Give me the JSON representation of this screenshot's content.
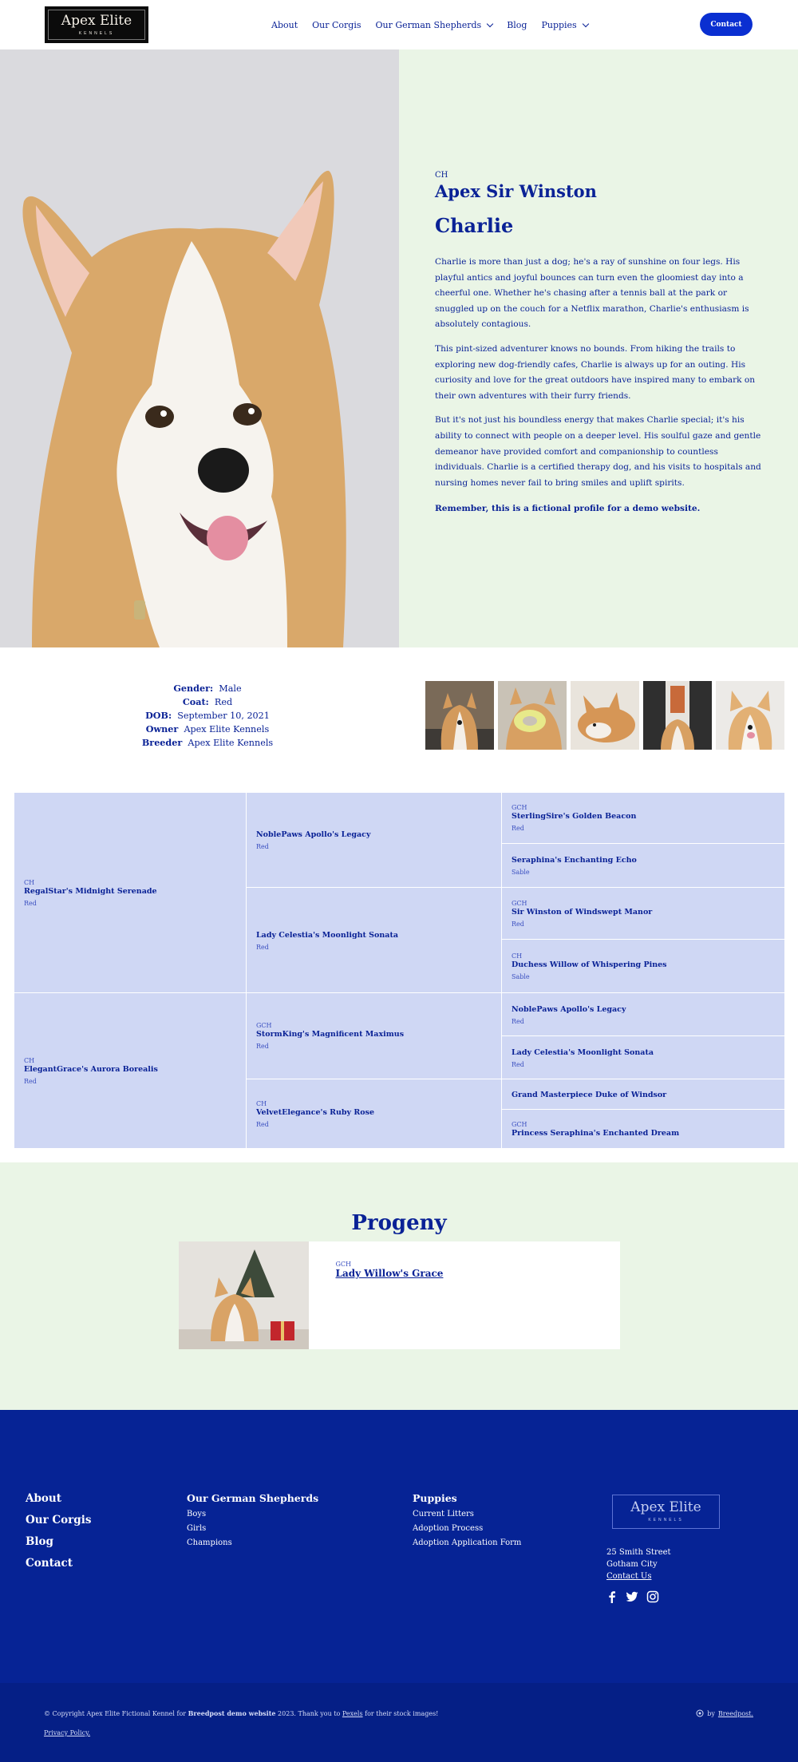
{
  "header": {
    "logo_name": "Apex Elite",
    "logo_sub": "KENNELS",
    "nav": [
      "About",
      "Our Corgis",
      "Our German Shepherds",
      "Blog",
      "Puppies"
    ],
    "contact": "Contact"
  },
  "hero": {
    "prefix": "CH",
    "name": "Apex Sir Winston",
    "call_name": "Charlie",
    "paragraphs": [
      "Charlie is more than just a dog; he's a ray of sunshine on four legs. His playful antics and joyful bounces can turn even the gloomiest day into a cheerful one. Whether he's chasing after a tennis ball at the park or snuggled up on the couch for a Netflix marathon, Charlie's enthusiasm is absolutely contagious.",
      "This pint-sized adventurer knows no bounds. From hiking the trails to exploring new dog-friendly cafes, Charlie is always up for an outing. His curiosity and love for the great outdoors have inspired many to embark on their own adventures with their furry friends.",
      "But it's not just his boundless energy that makes Charlie special; it's his ability to connect with people on a deeper level. His soulful gaze and gentle demeanor have provided comfort and companionship to countless individuals. Charlie is a certified therapy dog, and his visits to hospitals and nursing homes never fail to bring smiles and uplift spirits."
    ],
    "disclaimer": "Remember, this is a fictional profile for a demo website."
  },
  "info": {
    "gender_label": "Gender:",
    "gender": "Male",
    "coat_label": "Coat:",
    "coat": "Red",
    "dob_label": "DOB:",
    "dob": "September 10, 2021",
    "owner_label": "Owner",
    "owner": "Apex Elite Kennels",
    "breeder_label": "Breeder",
    "breeder": "Apex Elite Kennels"
  },
  "pedigree": {
    "sire": {
      "title": "CH",
      "name": "RegalStar's Midnight Serenade",
      "color": "Red"
    },
    "dam": {
      "title": "CH",
      "name": "ElegantGrace's Aurora Borealis",
      "color": "Red"
    },
    "gp": [
      {
        "title": "",
        "name": "NoblePaws Apollo's Legacy",
        "color": "Red"
      },
      {
        "title": "",
        "name": "Lady Celestia's Moonlight Sonata",
        "color": "Red"
      },
      {
        "title": "GCH",
        "name": "StormKing's Magnificent Maximus",
        "color": "Red"
      },
      {
        "title": "CH",
        "name": "VelvetElegance's Ruby Rose",
        "color": "Red"
      }
    ],
    "ggp": [
      {
        "title": "GCH",
        "name": "SterlingSire's Golden Beacon",
        "color": "Red"
      },
      {
        "title": "",
        "name": "Seraphina's Enchanting Echo",
        "color": "Sable"
      },
      {
        "title": "GCH",
        "name": "Sir Winston of Windswept Manor",
        "color": "Red"
      },
      {
        "title": "CH",
        "name": "Duchess Willow of Whispering Pines",
        "color": "Sable"
      },
      {
        "title": "",
        "name": "NoblePaws Apollo's Legacy",
        "color": "Red"
      },
      {
        "title": "",
        "name": "Lady Celestia's Moonlight Sonata",
        "color": "Red"
      },
      {
        "title": "",
        "name": "Grand Masterpiece Duke of Windsor",
        "color": ""
      },
      {
        "title": "GCH",
        "name": "Princess Seraphina's Enchanted Dream",
        "color": ""
      }
    ]
  },
  "progeny": {
    "heading": "Progeny",
    "title": "GCH",
    "name": "Lady Willow's Grace"
  },
  "footer": {
    "col1": [
      "About",
      "Our Corgis",
      "Blog",
      "Contact"
    ],
    "col2_head": "Our German Shepherds",
    "col2": [
      "Boys",
      "Girls",
      "Champions"
    ],
    "col3_head": "Puppies",
    "col3": [
      "Current Litters",
      "Adoption Process",
      "Adoption Application Form"
    ],
    "logo_name": "Apex Elite",
    "logo_sub": "KENNELS",
    "address1": "25 Smith Street",
    "address2": "Gotham City",
    "contact_us": "Contact Us",
    "copy_a": "© Copyright Apex Elite Fictional Kennel for ",
    "copy_b": "Breedpost demo website",
    "copy_c": " 2023. Thank you to ",
    "copy_d": "Pexels",
    "copy_e": " for their stock images!",
    "privacy": "Privacy Policy.",
    "credit_by": "by",
    "credit_link": "Breedpost."
  },
  "colors": {
    "primary": "#0a2296",
    "button": "#0a2fd1",
    "mint": "#eaf5e6",
    "pedigree": "#cfd7f4",
    "footer": "#062395"
  }
}
